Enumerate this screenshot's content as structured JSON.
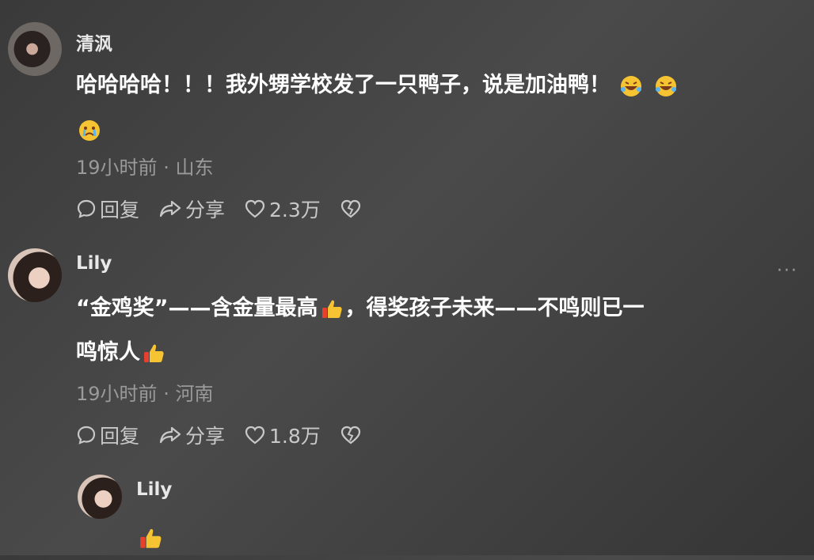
{
  "comments": [
    {
      "username": "清沨",
      "text": "哈哈哈哈！！！我外甥学校发了一只鸭子，说是加油鸭！",
      "time": "19小时前",
      "location": "山东",
      "reply_label": "回复",
      "share_label": "分享",
      "likes": "2.3万"
    },
    {
      "username": "Lily",
      "text_line1_a": "“金鸡奖”——含金量最高",
      "text_line1_b": "，得奖孩子未来——不鸣则已一",
      "text_line2": "鸣惊人",
      "time": "19小时前",
      "location": "河南",
      "reply_label": "回复",
      "share_label": "分享",
      "likes": "1.8万"
    }
  ],
  "reply": {
    "username": "Lily"
  },
  "separator": "·",
  "more_label": "···"
}
